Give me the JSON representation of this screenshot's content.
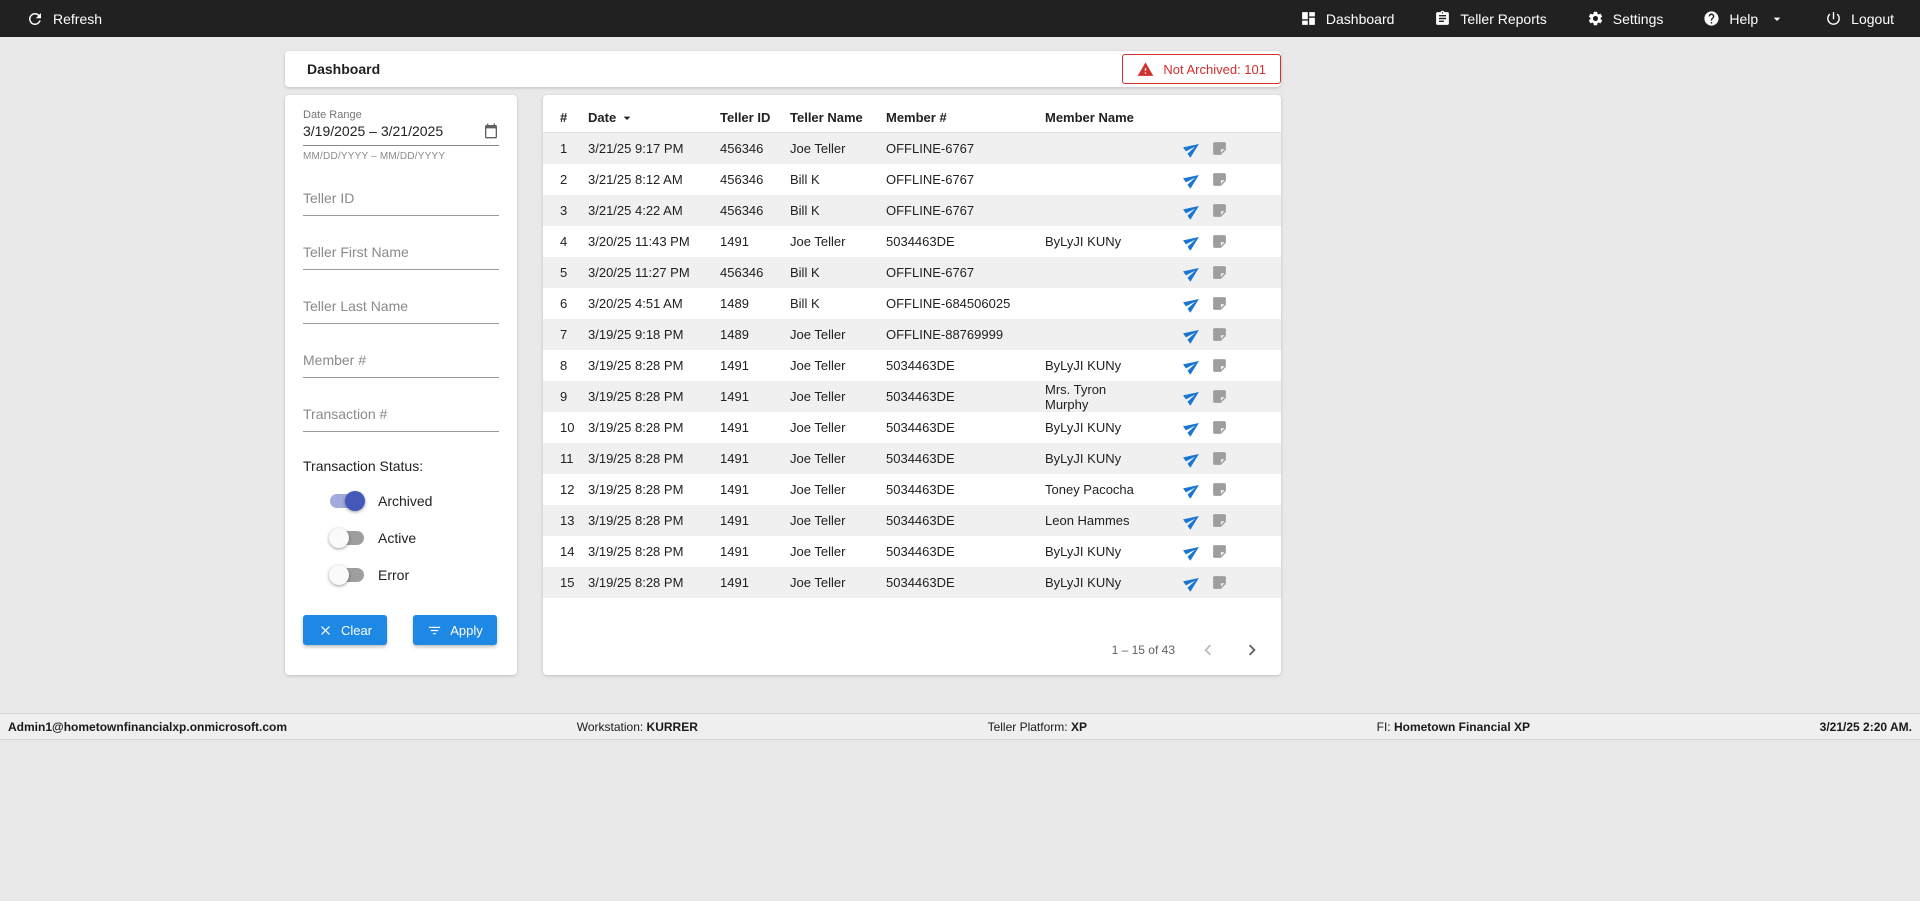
{
  "topbar": {
    "refresh_label": "Refresh",
    "nav": [
      {
        "label": "Dashboard"
      },
      {
        "label": "Teller Reports"
      },
      {
        "label": "Settings"
      },
      {
        "label": "Help"
      },
      {
        "label": "Logout"
      }
    ]
  },
  "header": {
    "title": "Dashboard",
    "not_archived_label": "Not Archived: 101"
  },
  "filters": {
    "date_range": {
      "label": "Date Range",
      "value": "3/19/2025 – 3/21/2025",
      "helper": "MM/DD/YYYY – MM/DD/YYYY"
    },
    "teller_id_placeholder": "Teller ID",
    "teller_first_name_placeholder": "Teller First Name",
    "teller_last_name_placeholder": "Teller Last Name",
    "member_placeholder": "Member #",
    "transaction_placeholder": "Transaction #",
    "status_label": "Transaction Status:",
    "toggles": [
      {
        "label": "Archived",
        "on": true
      },
      {
        "label": "Active",
        "on": false
      },
      {
        "label": "Error",
        "on": false
      }
    ],
    "clear_label": "Clear",
    "apply_label": "Apply"
  },
  "table": {
    "columns": {
      "num": "#",
      "date": "Date",
      "teller_id": "Teller ID",
      "teller_name": "Teller Name",
      "member": "Member #",
      "member_name": "Member Name"
    },
    "sort_column": "Date",
    "rows": [
      {
        "num": "1",
        "date": "3/21/25 9:17 PM",
        "teller_id": "456346",
        "teller_name": "Joe Teller",
        "member": "OFFLINE-6767",
        "member_name": ""
      },
      {
        "num": "2",
        "date": "3/21/25 8:12 AM",
        "teller_id": "456346",
        "teller_name": "Bill K",
        "member": "OFFLINE-6767",
        "member_name": ""
      },
      {
        "num": "3",
        "date": "3/21/25 4:22 AM",
        "teller_id": "456346",
        "teller_name": "Bill K",
        "member": "OFFLINE-6767",
        "member_name": ""
      },
      {
        "num": "4",
        "date": "3/20/25 11:43 PM",
        "teller_id": "1491",
        "teller_name": "Joe Teller",
        "member": "5034463DE",
        "member_name": "ByLyJI KUNy"
      },
      {
        "num": "5",
        "date": "3/20/25 11:27 PM",
        "teller_id": "456346",
        "teller_name": "Bill K",
        "member": "OFFLINE-6767",
        "member_name": ""
      },
      {
        "num": "6",
        "date": "3/20/25 4:51 AM",
        "teller_id": "1489",
        "teller_name": "Bill K",
        "member": "OFFLINE-684506025",
        "member_name": ""
      },
      {
        "num": "7",
        "date": "3/19/25 9:18 PM",
        "teller_id": "1489",
        "teller_name": "Joe Teller",
        "member": "OFFLINE-88769999",
        "member_name": ""
      },
      {
        "num": "8",
        "date": "3/19/25 8:28 PM",
        "teller_id": "1491",
        "teller_name": "Joe Teller",
        "member": "5034463DE",
        "member_name": "ByLyJI KUNy"
      },
      {
        "num": "9",
        "date": "3/19/25 8:28 PM",
        "teller_id": "1491",
        "teller_name": "Joe Teller",
        "member": "5034463DE",
        "member_name": "Mrs. Tyron Murphy"
      },
      {
        "num": "10",
        "date": "3/19/25 8:28 PM",
        "teller_id": "1491",
        "teller_name": "Joe Teller",
        "member": "5034463DE",
        "member_name": "ByLyJI KUNy"
      },
      {
        "num": "11",
        "date": "3/19/25 8:28 PM",
        "teller_id": "1491",
        "teller_name": "Joe Teller",
        "member": "5034463DE",
        "member_name": "ByLyJI KUNy"
      },
      {
        "num": "12",
        "date": "3/19/25 8:28 PM",
        "teller_id": "1491",
        "teller_name": "Joe Teller",
        "member": "5034463DE",
        "member_name": "Toney Pacocha"
      },
      {
        "num": "13",
        "date": "3/19/25 8:28 PM",
        "teller_id": "1491",
        "teller_name": "Joe Teller",
        "member": "5034463DE",
        "member_name": "Leon Hammes"
      },
      {
        "num": "14",
        "date": "3/19/25 8:28 PM",
        "teller_id": "1491",
        "teller_name": "Joe Teller",
        "member": "5034463DE",
        "member_name": "ByLyJI KUNy"
      },
      {
        "num": "15",
        "date": "3/19/25 8:28 PM",
        "teller_id": "1491",
        "teller_name": "Joe Teller",
        "member": "5034463DE",
        "member_name": "ByLyJI KUNy"
      }
    ],
    "pagination": {
      "range_label": "1 – 15 of 43"
    }
  },
  "footer": {
    "user": "Admin1@hometownfinancialxp.onmicrosoft.com",
    "workstation_label": "Workstation:",
    "workstation_value": "KURRER",
    "platform_label": "Teller Platform:",
    "platform_value": "XP",
    "fi_label": "FI:",
    "fi_value": "Hometown Financial XP",
    "datetime": "3/21/25 2:20 AM."
  },
  "colors": {
    "accent_blue": "#1e88e5",
    "icon_blue": "#1976d2",
    "toggle_on": "#4458b9",
    "alert_red": "#d32f2f",
    "topbar_bg": "#212121"
  }
}
